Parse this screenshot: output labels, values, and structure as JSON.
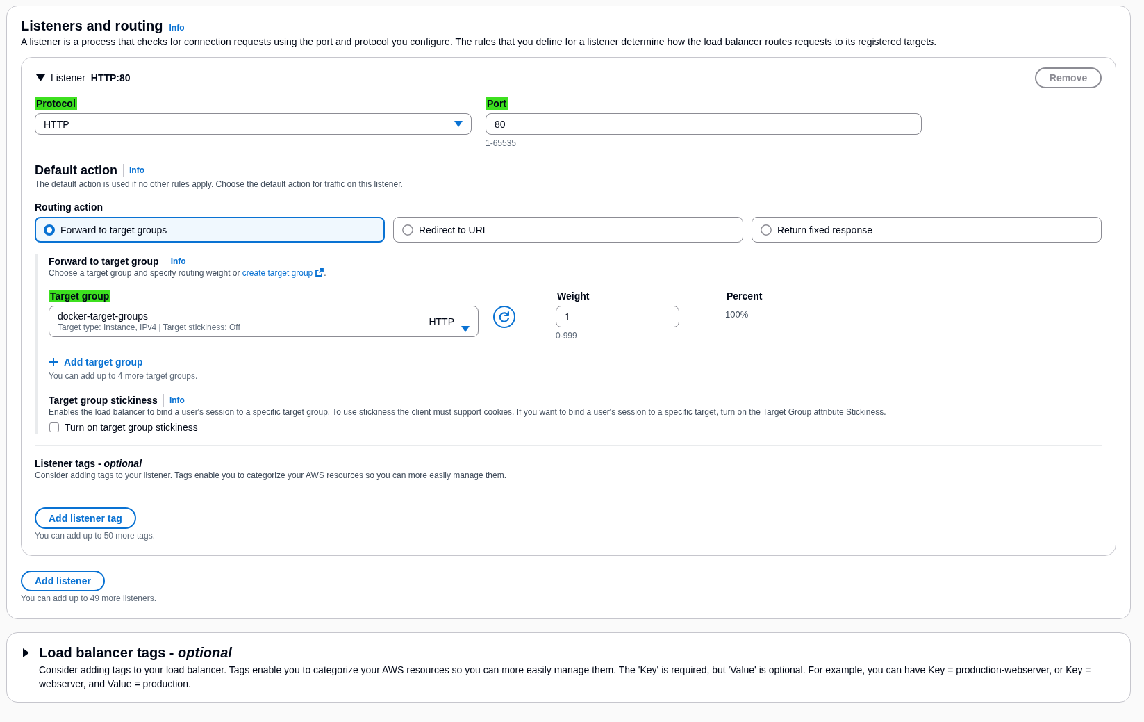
{
  "section": {
    "title": "Listeners and routing",
    "info": "Info",
    "description": "A listener is a process that checks for connection requests using the port and protocol you configure. The rules that you define for a listener determine how the load balancer routes requests to its registered targets."
  },
  "listener": {
    "expanded": true,
    "label": "Listener",
    "name": "HTTP:80",
    "remove_button": {
      "label": "Remove",
      "disabled": true
    },
    "protocol": {
      "label": "Protocol",
      "highlighted": true,
      "value": "HTTP"
    },
    "port": {
      "label": "Port",
      "highlighted": true,
      "value": "80",
      "hint": "1-65535"
    },
    "default_action": {
      "title": "Default action",
      "info": "Info",
      "description": "The default action is used if no other rules apply. Choose the default action for traffic on this listener."
    },
    "routing_action": {
      "label": "Routing action",
      "options": [
        {
          "label": "Forward to target groups",
          "selected": true
        },
        {
          "label": "Redirect to URL",
          "selected": false
        },
        {
          "label": "Return fixed response",
          "selected": false
        }
      ]
    },
    "forward": {
      "title": "Forward to target group",
      "info": "Info",
      "description": "Choose a target group and specify routing weight or ",
      "link": "create target group",
      "description_end": ".",
      "target_groups": [
        {
          "group": {
            "label": "Target group",
            "highlighted": true,
            "name": "docker-target-groups",
            "details": "Target type: Instance, IPv4 | Target stickiness: Off",
            "protocol": "HTTP"
          },
          "weight": {
            "label": "Weight",
            "highlighted": false,
            "value": "1",
            "hint": "0-999"
          },
          "percent": {
            "label": "Percent",
            "highlighted": false,
            "value": "100%"
          }
        }
      ],
      "add_target_group": {
        "label": "Add target group",
        "hint": "You can add up to 4 more target groups."
      },
      "stickiness": {
        "title": "Target group stickiness",
        "info": "Info",
        "description": "Enables the load balancer to bind a user's session to a specific target group. To use stickiness the client must support cookies. If you want to bind a user's session to a specific target, turn on the Target Group attribute Stickiness.",
        "checkbox": {
          "label": "Turn on target group stickiness",
          "checked": false
        }
      }
    },
    "tags": {
      "title": "Listener tags - *optional*",
      "description": "Consider adding tags to your listener. Tags enable you to categorize your AWS resources so you can more easily manage them.",
      "button": "Add listener tag",
      "hint": "You can add up to 50 more tags."
    }
  },
  "add_listener": {
    "label": "Add listener",
    "hint": "You can add up to 49 more listeners."
  },
  "load_balancer_tags": {
    "expanded": false,
    "title": "Load balancer tags - *optional*",
    "description": "Consider adding tags to your load balancer. Tags enable you to categorize your AWS resources so you can more easily manage them. The 'Key' is required, but 'Value' is optional. For example, you can have Key = production-webserver, or Key = webserver, and Value = production."
  }
}
